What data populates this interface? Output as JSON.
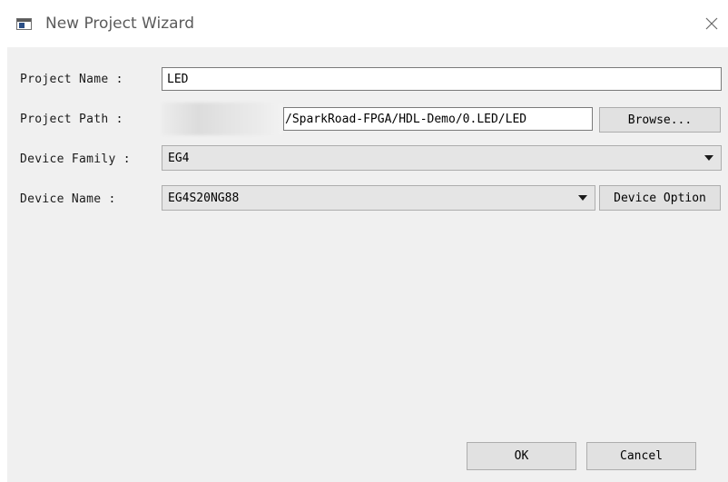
{
  "window": {
    "title": "New Project Wizard"
  },
  "form": {
    "project_name": {
      "label": "Project Name :",
      "value": "LED"
    },
    "project_path": {
      "label": "Project Path :",
      "value": "/SparkRoad-FPGA/HDL-Demo/0.LED/LED",
      "browse_label": "Browse..."
    },
    "device_family": {
      "label": "Device Family :",
      "value": "EG4"
    },
    "device_name": {
      "label": "Device Name :",
      "value": "EG4S20NG88",
      "option_label": "Device Option"
    }
  },
  "footer": {
    "ok_label": "OK",
    "cancel_label": "Cancel"
  },
  "icons": {
    "app": "window-app-icon",
    "close": "close-icon",
    "dropdown": "chevron-down-icon"
  }
}
